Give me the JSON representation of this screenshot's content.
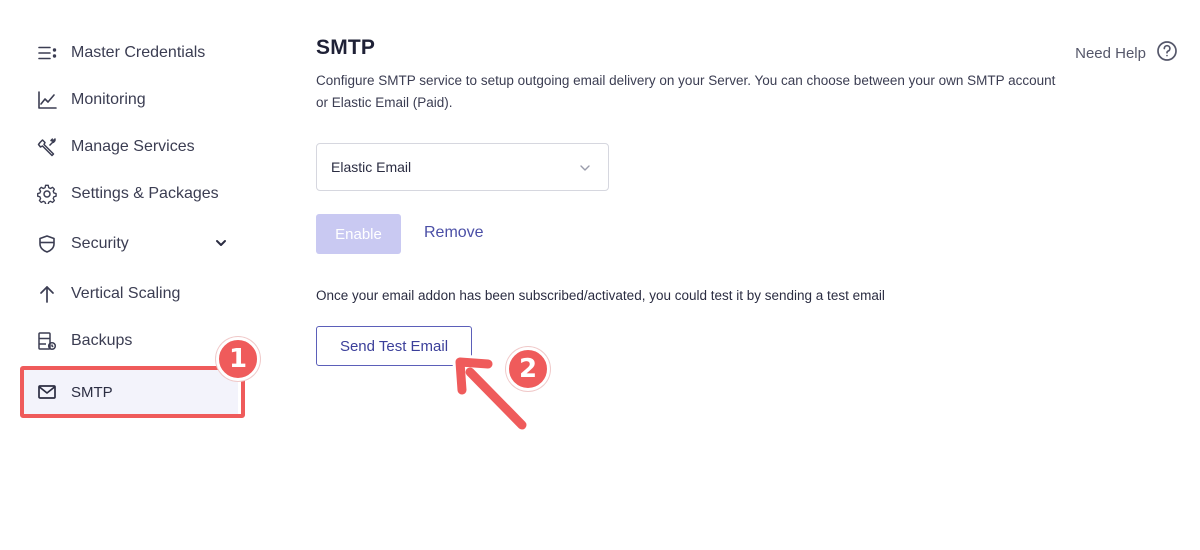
{
  "sidebar": {
    "items": [
      {
        "label": "Master Credentials",
        "icon": "list-icon"
      },
      {
        "label": "Monitoring",
        "icon": "chart-icon"
      },
      {
        "label": "Manage Services",
        "icon": "wrench-icon"
      },
      {
        "label": "Settings & Packages",
        "icon": "gear-icon"
      },
      {
        "label": "Security",
        "icon": "shield-icon"
      },
      {
        "label": "Vertical Scaling",
        "icon": "arrow-up-icon"
      },
      {
        "label": "Backups",
        "icon": "backup-icon"
      },
      {
        "label": "SMTP",
        "icon": "mail-icon"
      }
    ],
    "active": "SMTP"
  },
  "main": {
    "title": "SMTP",
    "description": "Configure SMTP service to setup outgoing email delivery on your Server. You can choose between your own SMTP account or Elastic Email (Paid).",
    "help_label": "Need Help",
    "provider_select": {
      "value": "Elastic Email"
    },
    "enable_label": "Enable",
    "remove_label": "Remove",
    "info_text": "Once your email addon has been subscribed/activated, you could test it by sending a test email",
    "test_button_label": "Send Test Email"
  },
  "annotations": {
    "badge_1": "1",
    "badge_2": "2",
    "color": "#ef5b5b"
  },
  "colors": {
    "accent": "#4b4fa6",
    "disabled_button": "#c9c9f2",
    "active_nav_bg": "#f3f3fb"
  }
}
